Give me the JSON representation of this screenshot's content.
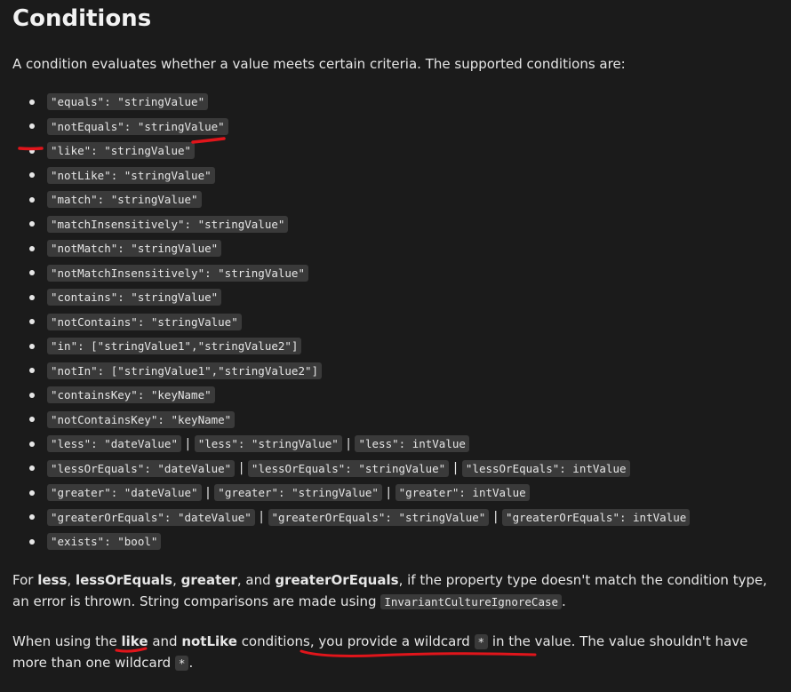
{
  "heading": "Conditions",
  "intro": "A condition evaluates whether a value meets certain criteria. The supported conditions are:",
  "conditions": [
    {
      "parts": [
        "\"equals\": \"stringValue\""
      ]
    },
    {
      "parts": [
        "\"notEquals\": \"stringValue\""
      ]
    },
    {
      "parts": [
        "\"like\": \"stringValue\""
      ]
    },
    {
      "parts": [
        "\"notLike\": \"stringValue\""
      ]
    },
    {
      "parts": [
        "\"match\": \"stringValue\""
      ]
    },
    {
      "parts": [
        "\"matchInsensitively\": \"stringValue\""
      ]
    },
    {
      "parts": [
        "\"notMatch\": \"stringValue\""
      ]
    },
    {
      "parts": [
        "\"notMatchInsensitively\": \"stringValue\""
      ]
    },
    {
      "parts": [
        "\"contains\": \"stringValue\""
      ]
    },
    {
      "parts": [
        "\"notContains\": \"stringValue\""
      ]
    },
    {
      "parts": [
        "\"in\": [\"stringValue1\",\"stringValue2\"]"
      ]
    },
    {
      "parts": [
        "\"notIn\": [\"stringValue1\",\"stringValue2\"]"
      ]
    },
    {
      "parts": [
        "\"containsKey\": \"keyName\""
      ]
    },
    {
      "parts": [
        "\"notContainsKey\": \"keyName\""
      ]
    },
    {
      "parts": [
        "\"less\": \"dateValue\"",
        "\"less\": \"stringValue\"",
        "\"less\": intValue"
      ]
    },
    {
      "parts": [
        "\"lessOrEquals\": \"dateValue\"",
        "\"lessOrEquals\": \"stringValue\"",
        "\"lessOrEquals\": intValue"
      ]
    },
    {
      "parts": [
        "\"greater\": \"dateValue\"",
        "\"greater\": \"stringValue\"",
        "\"greater\": intValue"
      ]
    },
    {
      "parts": [
        "\"greaterOrEquals\": \"dateValue\"",
        "\"greaterOrEquals\": \"stringValue\"",
        "\"greaterOrEquals\": intValue"
      ]
    },
    {
      "parts": [
        "\"exists\": \"bool\""
      ]
    }
  ],
  "separator": "|",
  "paragraph1": {
    "t1": "For ",
    "b1": "less",
    "t2": ", ",
    "b2": "lessOrEquals",
    "t3": ", ",
    "b3": "greater",
    "t4": ", and ",
    "b4": "greaterOrEquals",
    "t5": ", if the property type doesn't match the condition type, an error is thrown. String comparisons are made using ",
    "code": "InvariantCultureIgnoreCase",
    "t6": "."
  },
  "paragraph2": {
    "t1": "When using the ",
    "b1": "like",
    "t2": " and ",
    "b2": "notLike",
    "t3": " conditions, you provide a wildcard ",
    "code1": "*",
    "t4": " in the value. The value shouldn't have more than one wildcard ",
    "code2": "*",
    "t5": "."
  },
  "annotation_color": "#e0151b"
}
